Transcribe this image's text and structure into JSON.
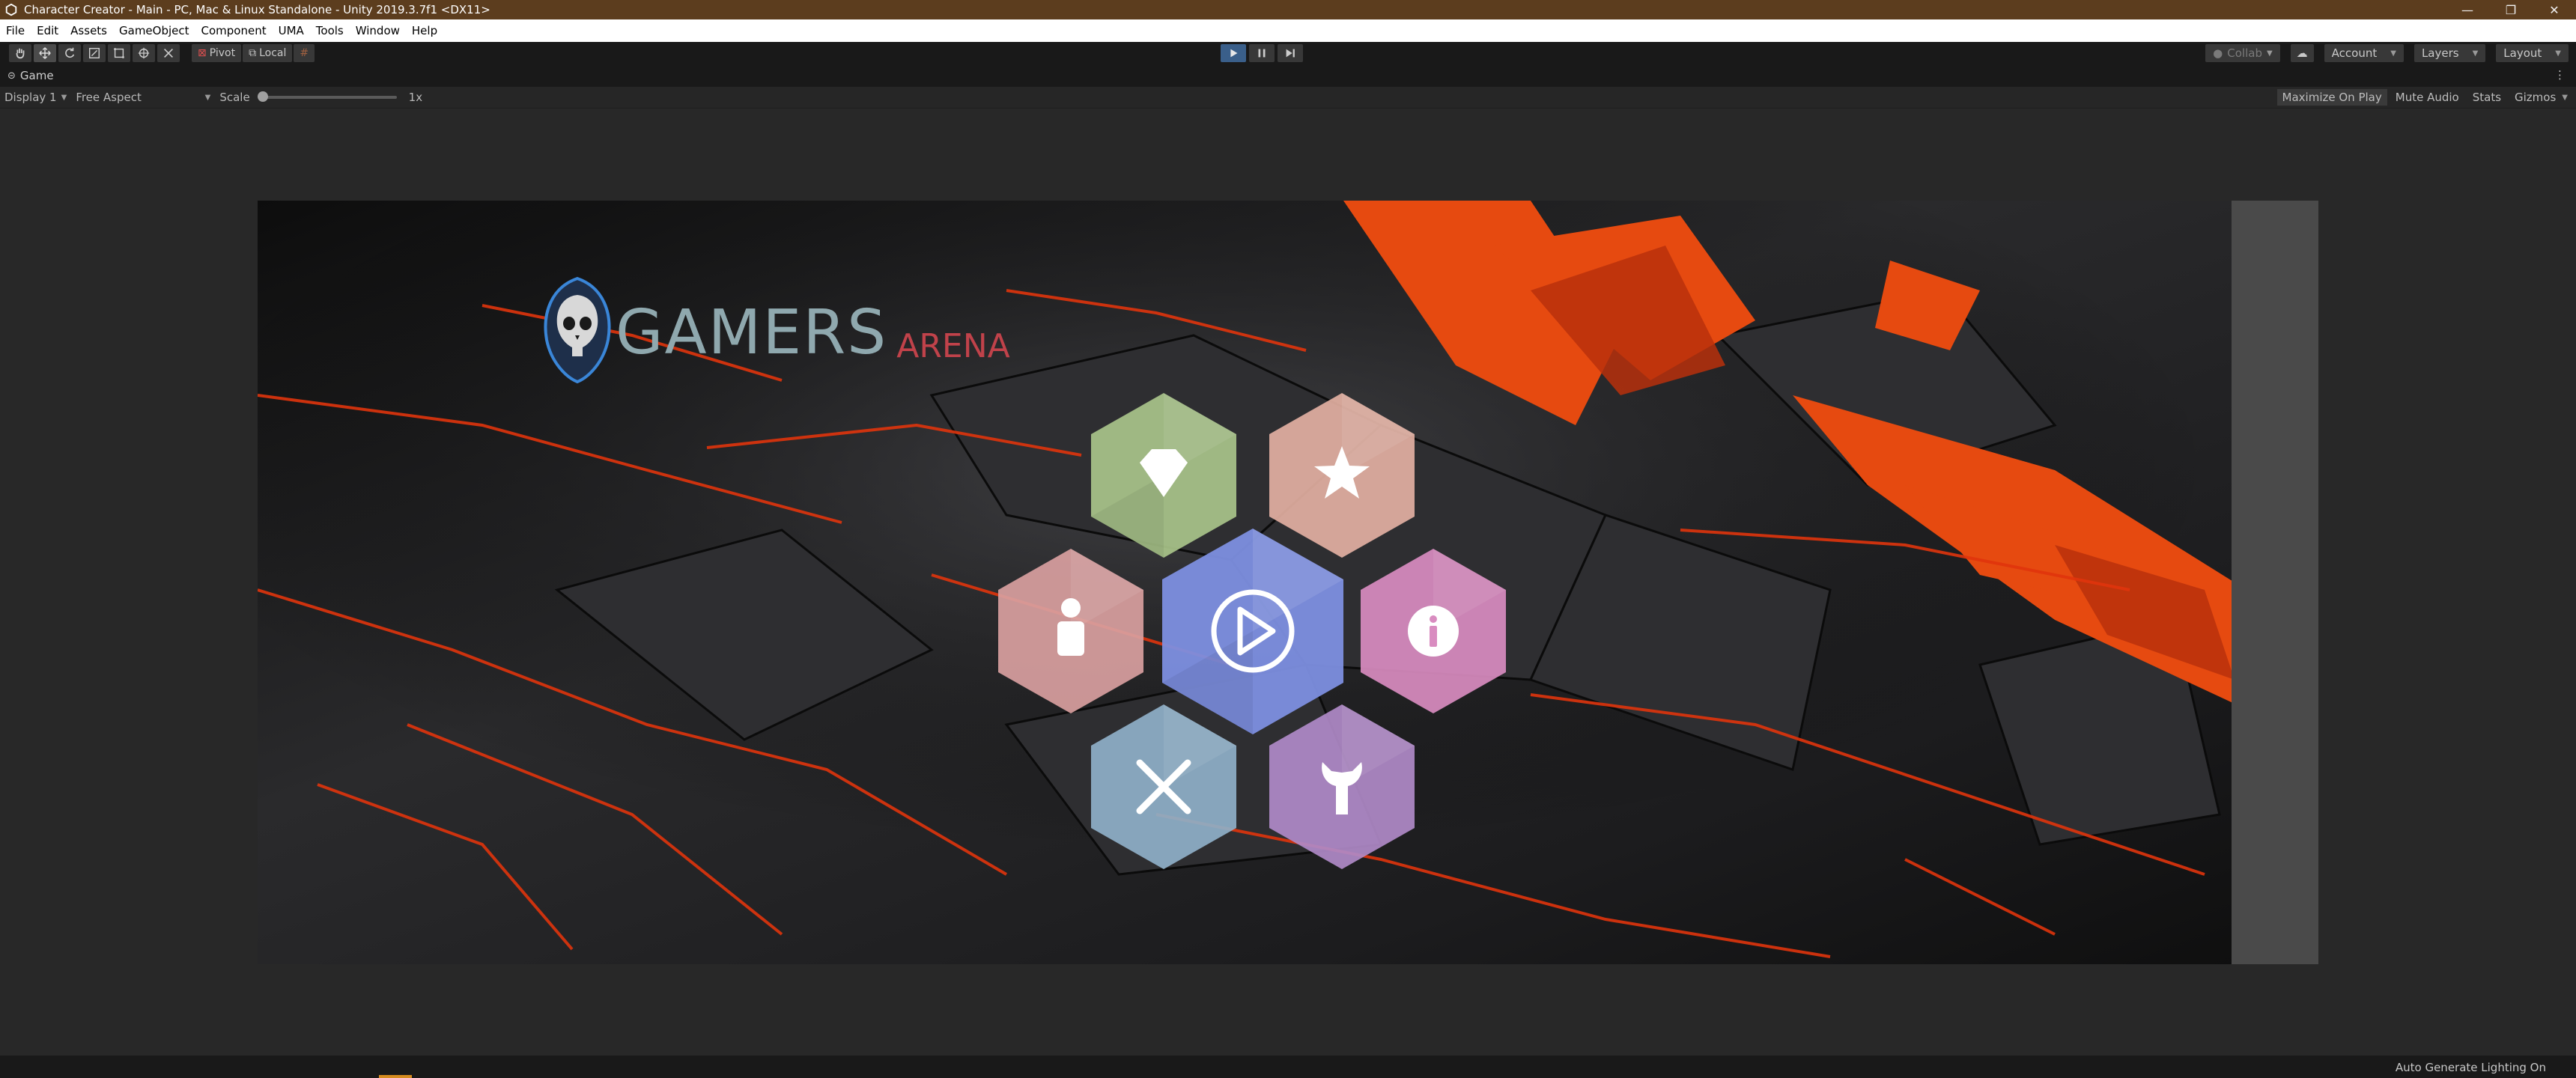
{
  "window": {
    "title": "Character Creator - Main - PC, Mac & Linux Standalone - Unity 2019.3.7f1 <DX11>",
    "icons": [
      "unity-icon",
      "minimize-icon",
      "restore-icon",
      "close-icon"
    ]
  },
  "menubar": {
    "items": [
      "File",
      "Edit",
      "Assets",
      "GameObject",
      "Component",
      "UMA",
      "Tools",
      "Window",
      "Help"
    ]
  },
  "toolbar": {
    "pivot_label": "Pivot",
    "local_label": "Local",
    "collab_label": "Collab",
    "account_label": "Account",
    "layers_label": "Layers",
    "layout_label": "Layout"
  },
  "game_tab": {
    "label": "Game"
  },
  "game_bar": {
    "display_label": "Display 1",
    "aspect_label": "Free Aspect",
    "scale_label": "Scale",
    "scale_value": "1x",
    "maximize_label": "Maximize On Play",
    "mute_label": "Mute Audio",
    "stats_label": "Stats",
    "gizmos_label": "Gizmos"
  },
  "game": {
    "logo_primary": "GAMERS",
    "logo_secondary": "ARENA",
    "menu_buttons": [
      {
        "name": "diamond-button",
        "icon": "diamond-icon",
        "color": "#a9c48a"
      },
      {
        "name": "star-button",
        "icon": "star-icon",
        "color": "#e3b0a2"
      },
      {
        "name": "profile-button",
        "icon": "person-icon",
        "color": "#d9a0a0"
      },
      {
        "name": "play-button",
        "icon": "play-icon",
        "color": "#7d8fe0"
      },
      {
        "name": "info-button",
        "icon": "info-icon",
        "color": "#d98cc0"
      },
      {
        "name": "exit-button",
        "icon": "close-icon",
        "color": "#8fb0c8"
      },
      {
        "name": "settings-button",
        "icon": "wrench-icon",
        "color": "#b08ac8"
      }
    ]
  },
  "statusbar": {
    "text": "Auto Generate Lighting On"
  }
}
